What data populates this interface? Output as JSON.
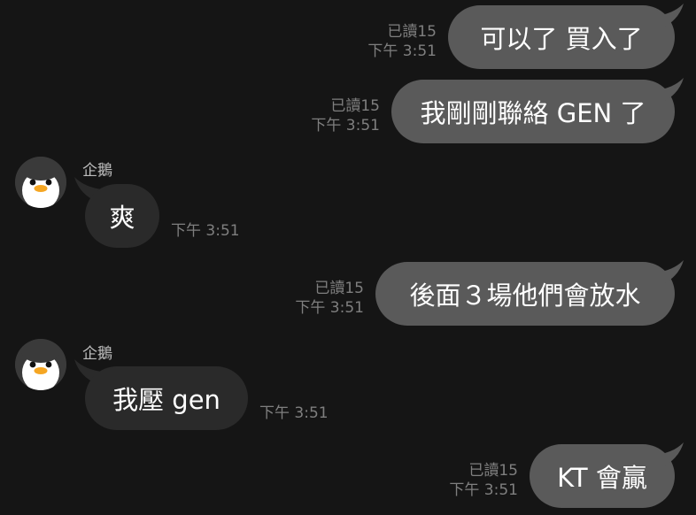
{
  "messages": [
    {
      "direction": "out",
      "text": "可以了 買入了",
      "read": "已讀15",
      "time": "下午 3:51"
    },
    {
      "direction": "out",
      "text": "我剛剛聯絡 GEN 了",
      "read": "已讀15",
      "time": "下午 3:51"
    },
    {
      "direction": "in",
      "sender": "企鵝",
      "avatar": "penguin-avatar",
      "text": "爽",
      "time": "下午 3:51"
    },
    {
      "direction": "out",
      "text": "後面３場他們會放水",
      "read": "已讀15",
      "time": "下午 3:51"
    },
    {
      "direction": "in",
      "sender": "企鵝",
      "avatar": "penguin-avatar",
      "text": "我壓 gen",
      "time": "下午 3:51"
    },
    {
      "direction": "out",
      "text": "KT 會贏",
      "read": "已讀15",
      "time": "下午 3:51"
    }
  ],
  "colors": {
    "background": "#151515",
    "outgoing_bubble": "#5a5a5a",
    "incoming_bubble": "#2a2a2a",
    "meta_text": "#7f7f7f"
  }
}
